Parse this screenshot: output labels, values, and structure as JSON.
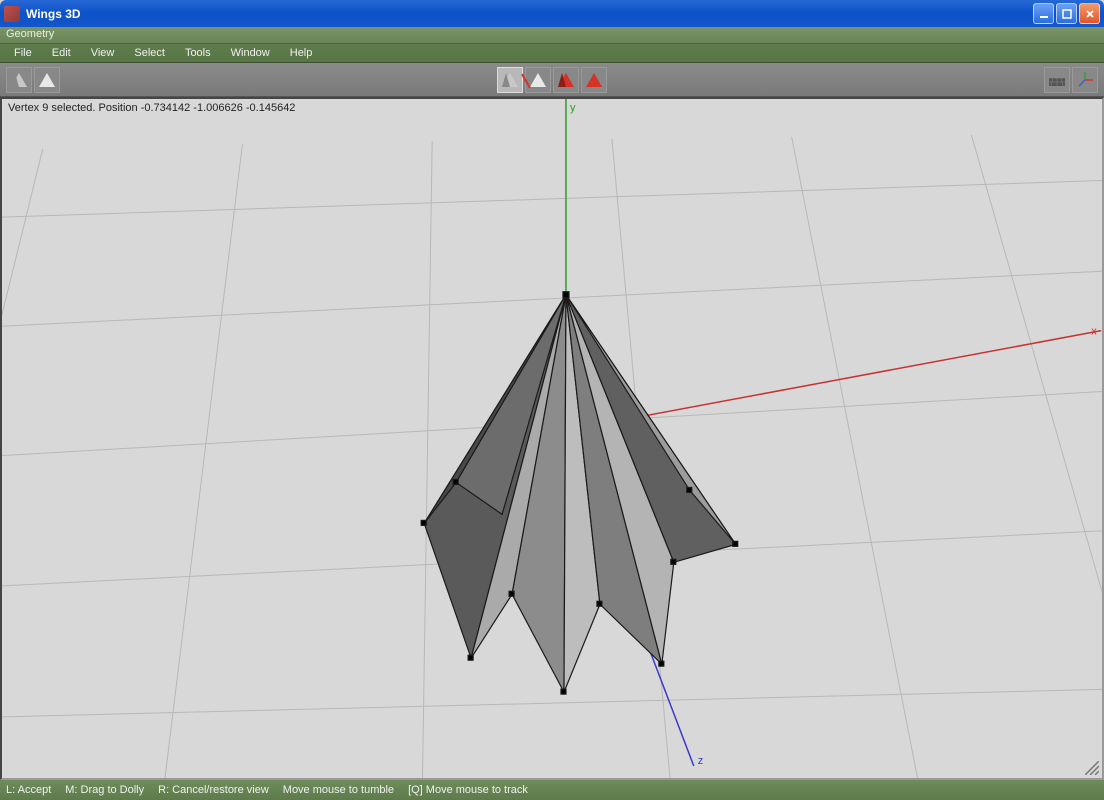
{
  "window": {
    "title": "Wings 3D"
  },
  "docbar": {
    "label": "Geometry"
  },
  "menu": {
    "file": "File",
    "edit": "Edit",
    "view": "View",
    "select": "Select",
    "tools": "Tools",
    "window": "Window",
    "help": "Help"
  },
  "status": {
    "text": "Vertex 9 selected. Position -0.734142 -1.006626 -0.145642"
  },
  "axes": {
    "x": "x",
    "y": "y",
    "z": "z"
  },
  "bottom": {
    "l": "L: Accept",
    "m": "M: Drag to Dolly",
    "r": "R: Cancel/restore view",
    "hint1": "Move mouse to tumble",
    "hint2": "[Q] Move mouse to track"
  },
  "toolbar": {
    "left": [
      "smooth-shade",
      "flat-shade"
    ],
    "center": [
      "sel-vertex",
      "sel-edge",
      "sel-face",
      "sel-body"
    ],
    "right": [
      "ground-plane",
      "axes-toggle"
    ]
  }
}
